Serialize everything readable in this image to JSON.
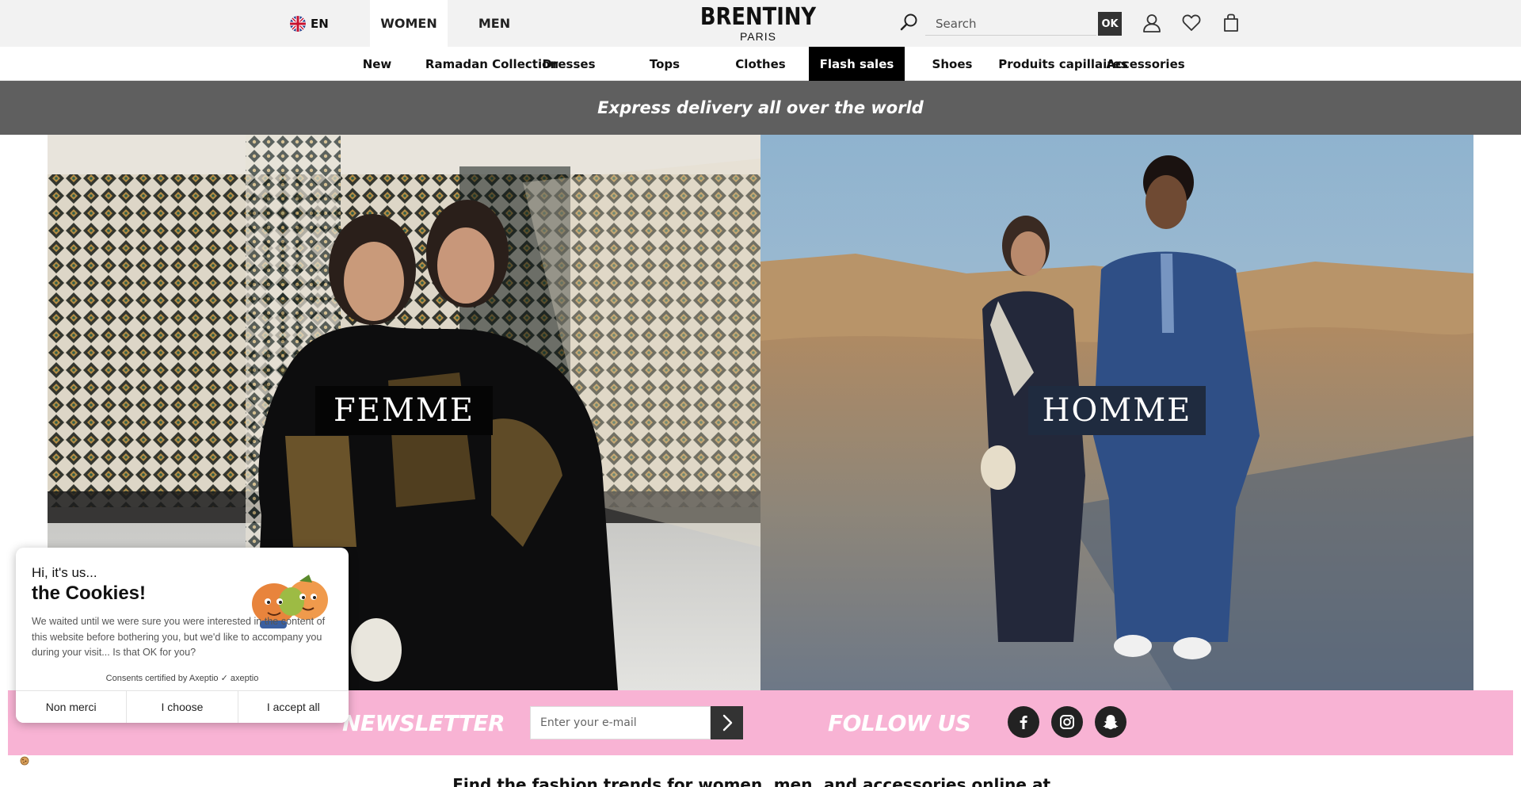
{
  "header": {
    "language": "EN",
    "gender_tabs": [
      {
        "label": "WOMEN",
        "active": true
      },
      {
        "label": "MEN",
        "active": false
      }
    ],
    "logo_main": "BRENTINY",
    "logo_sub": "PARIS",
    "search_placeholder": "Search",
    "search_button": "OK",
    "icons": [
      "search-icon",
      "user-icon",
      "heart-icon",
      "shopping-bag-icon"
    ]
  },
  "category_nav": {
    "items": [
      {
        "label": "New",
        "active": false
      },
      {
        "label": "Ramadan Collection",
        "active": false
      },
      {
        "label": "Dresses",
        "active": false
      },
      {
        "label": "Tops",
        "active": false
      },
      {
        "label": "Clothes",
        "active": false
      },
      {
        "label": "Flash sales",
        "active": true
      },
      {
        "label": "Shoes",
        "active": false
      },
      {
        "label": "Produits capillaires",
        "active": false
      },
      {
        "label": "Accessories",
        "active": false
      }
    ]
  },
  "promo": {
    "text": "Express delivery all over the world"
  },
  "hero": {
    "femme_label": "FEMME",
    "homme_label": "HOMME"
  },
  "newsletter": {
    "title": "NEWSLETTER",
    "email_placeholder": "Enter your e-mail",
    "follow_title": "FOLLOW US",
    "social": [
      "facebook-icon",
      "instagram-icon",
      "snapchat-icon"
    ]
  },
  "tagline": "Find the fashion trends for women, men, and accessories online at...",
  "cookie": {
    "greeting": "Hi, it's us...",
    "title": "the Cookies!",
    "body": "We waited until we were sure you were interested in the content of this website before bothering you, but we'd like to accompany you during your visit... Is that OK for you?",
    "certified": "Consents certified by Axeptio",
    "certified_brand": "axeptio",
    "buttons": {
      "refuse": "Non merci",
      "choose": "I choose",
      "accept": "I accept all"
    }
  },
  "colors": {
    "topbar": "#f2f2f2",
    "promo_bg": "#5f5f5f",
    "newsletter_bg": "#f8b3d4",
    "active_nav": "#000000"
  }
}
